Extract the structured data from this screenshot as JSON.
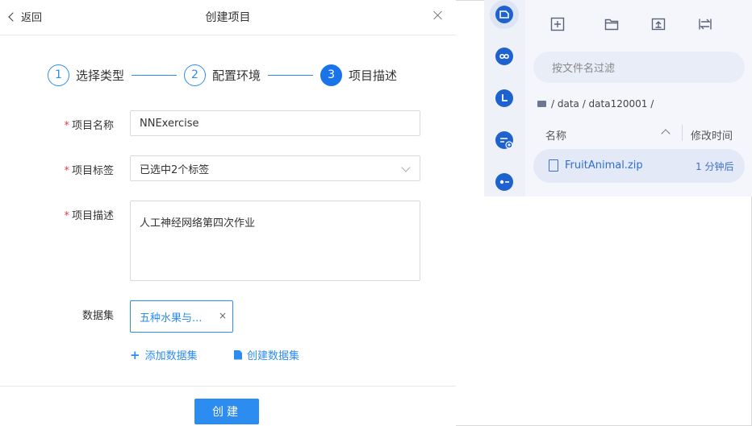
{
  "dialog": {
    "back_label": "返回",
    "title": "创建项目",
    "steps": [
      {
        "num": "1",
        "label": "选择类型"
      },
      {
        "num": "2",
        "label": "配置环境"
      },
      {
        "num": "3",
        "label": "项目描述"
      }
    ],
    "fields": {
      "name_label": "项目名称",
      "name_value": "NNExercise",
      "tags_label": "项目标签",
      "tags_value": "已选中2个标签",
      "desc_label": "项目描述",
      "desc_value": "人工神经网络第四次作业",
      "dataset_label": "数据集",
      "dataset_tag": "五种水果与..."
    },
    "required_mark": "*",
    "tag_remove": "×",
    "add_dataset": "添加数据集",
    "add_icon": "+",
    "create_dataset": "创建数据集",
    "create_button": "创建"
  },
  "file_browser": {
    "filter_placeholder": "按文件名过滤",
    "breadcrumb": "/ data / data120001 /",
    "col_name": "名称",
    "col_modified": "修改时间",
    "files": [
      {
        "name": "FruitAnimal.zip",
        "modified": "1 分钟后"
      }
    ],
    "toolbar_icons": [
      "new-file-icon",
      "folder-icon",
      "upload-icon",
      "refresh-icon"
    ],
    "rail_icons": [
      "notebook-icon",
      "infinity-icon",
      "clock-icon",
      "add-list-icon",
      "toggle-icon"
    ]
  },
  "colors": {
    "accent": "#2d8cf0",
    "step_active": "#1a73e8",
    "rail_bg": "#eef1f8",
    "panel_bg": "#f4f6fb"
  }
}
